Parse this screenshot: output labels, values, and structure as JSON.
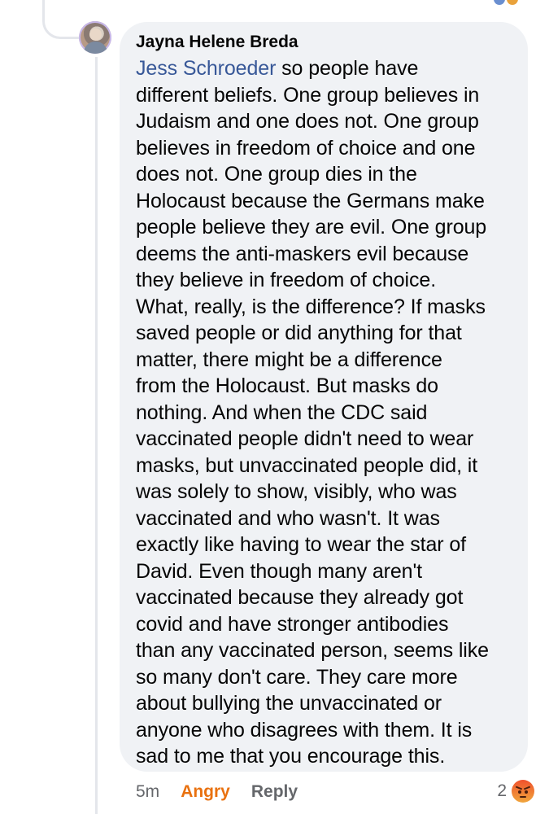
{
  "comment": {
    "author": "Jayna Helene Breda",
    "mention": "Jess Schroeder",
    "lines": [
      " so people have",
      "different beliefs. One group believes in",
      "Judaism and one does not. One group",
      "believes in freedom of choice and one",
      "does not. One group dies in the",
      "Holocaust because the Germans make",
      "people believe they are evil. One group",
      "deems the anti-maskers evil because",
      "they believe in freedom of choice.",
      "What, really, is the difference? If masks",
      "saved people or did anything for that",
      "matter, there might be a difference",
      "from the Holocaust. But masks do",
      "nothing. And when the CDC said",
      "vaccinated people didn't need to wear",
      "masks, but unvaccinated people did, it",
      "was solely to show, visibly, who was",
      "vaccinated and who wasn't. It was",
      "exactly like having to wear the star of",
      "David. Even though many aren't",
      "vaccinated because they already got",
      "covid and have stronger antibodies",
      "than any vaccinated person, seems like",
      "so many don't care. They care more",
      "about bullying the unvaccinated or",
      "anyone who disagrees with them. It is",
      "sad to me that you encourage this."
    ]
  },
  "actions": {
    "timestamp": "5m",
    "reaction_label": "Angry",
    "reply_label": "Reply"
  },
  "reactions": {
    "count": "2",
    "icon": "angry-reaction-icon"
  },
  "colors": {
    "bubble": "#f0f2f5",
    "mention": "#385898",
    "angry": "#e9710f",
    "muted": "#65676b"
  }
}
